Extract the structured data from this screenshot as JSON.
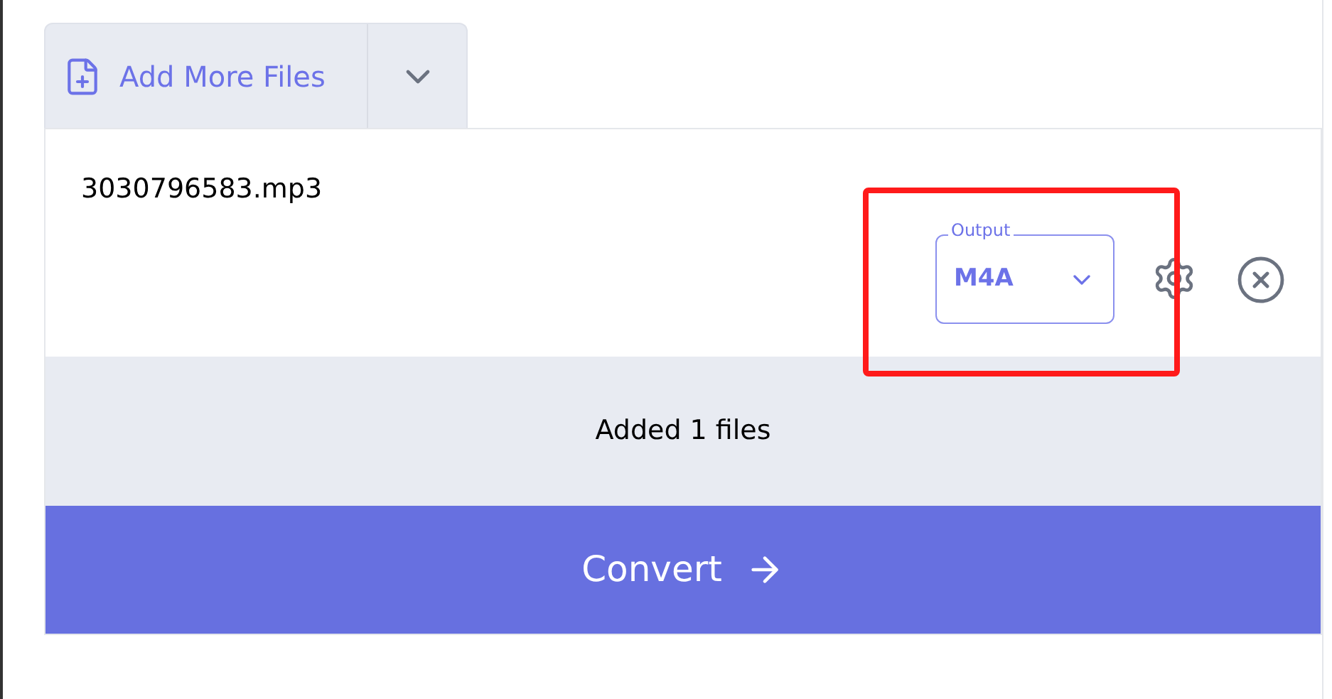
{
  "add_files": {
    "label": "Add More Files"
  },
  "files": [
    {
      "name": "3030796583.mp3",
      "output": {
        "label": "Output",
        "value": "M4A"
      },
      "highlighted": true
    }
  ],
  "status": "Added 1 files",
  "convert_button": {
    "label": "Convert"
  }
}
